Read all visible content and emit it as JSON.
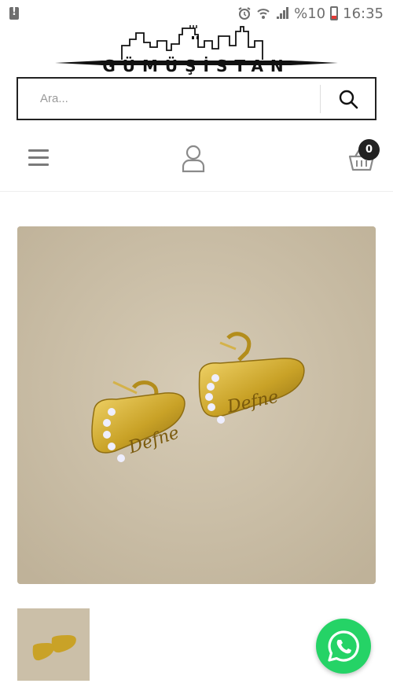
{
  "status_bar": {
    "battery": "%10",
    "time": "16:35",
    "icons": [
      "alert-icon",
      "alarm-icon",
      "wifi-icon",
      "signal-icon",
      "battery-icon"
    ]
  },
  "brand": {
    "name": "GÜMÜŞİSTAN"
  },
  "search": {
    "placeholder": "Ara...",
    "value": ""
  },
  "nav": {
    "cart_count": "0",
    "icons": [
      "menu-icon",
      "user-icon",
      "cart-icon"
    ]
  },
  "product": {
    "engraving": "Defne"
  },
  "colors": {
    "whatsapp": "#25d366",
    "gold": "#c9a227",
    "background_fabric": "#cfc3ad"
  }
}
